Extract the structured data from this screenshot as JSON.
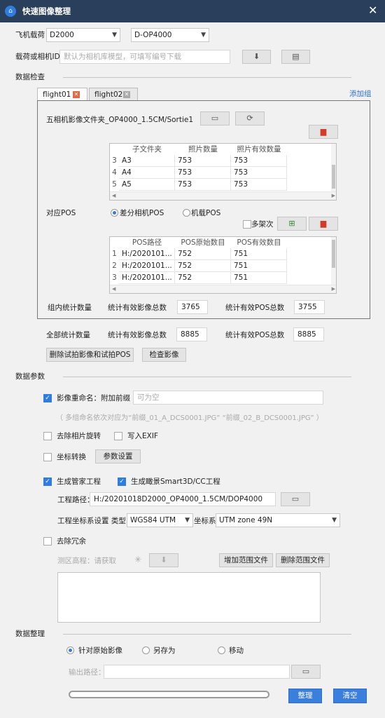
{
  "window": {
    "title": "快速图像整理",
    "close": "✕",
    "logo": "⌂"
  },
  "platform": {
    "aircraft_label": "飞机载荷",
    "aircraft": "D2000",
    "payload": "D-OP4000"
  },
  "camera_id": {
    "label": "载荷或相机ID",
    "placeholder": "默认为相机库模型，可填写编号下载"
  },
  "sections": {
    "check": "数据检查",
    "params": "数据参数",
    "organize": "数据整理"
  },
  "tabs": [
    {
      "label": "flight01"
    },
    {
      "label": "flight02"
    }
  ],
  "add_group": "添加组",
  "images": {
    "folder_label": "五相机影像文件夹",
    "folder_value": "_OP4000_1.5CM/Sortie1",
    "columns": [
      "子文件夹",
      "照片数量",
      "照片有效数量"
    ],
    "rows": [
      {
        "no": "3",
        "a": "A3",
        "b": "753",
        "c": "753"
      },
      {
        "no": "4",
        "a": "A4",
        "b": "753",
        "c": "753"
      },
      {
        "no": "5",
        "a": "A5",
        "b": "753",
        "c": "753"
      }
    ]
  },
  "pos": {
    "label": "对应POS",
    "radio_diff": "差分相机POS",
    "radio_onboard": "机载POS",
    "multi": "多架次",
    "columns": [
      "POS路径",
      "POS原始数目",
      "POS有效数目"
    ],
    "rows": [
      {
        "no": "1",
        "a": "H:/2020101...",
        "b": "752",
        "c": "751"
      },
      {
        "no": "2",
        "a": "H:/2020101...",
        "b": "752",
        "c": "751"
      },
      {
        "no": "3",
        "a": "H:/2020101...",
        "b": "752",
        "c": "751"
      }
    ]
  },
  "group_stats": {
    "label": "组内统计数量",
    "img_label": "统计有效影像总数",
    "img_value": "3765",
    "pos_label": "统计有效POS总数",
    "pos_value": "3755"
  },
  "total_stats": {
    "label": "全部统计数量",
    "img_label": "统计有效影像总数",
    "img_value": "8885",
    "pos_label": "统计有效POS总数",
    "pos_value": "8885"
  },
  "actions": {
    "remove_test": "删除试拍影像和试拍POS",
    "check_images": "检查影像"
  },
  "params": {
    "rename_label": "影像重命名：附加前缀",
    "rename_placeholder": "可为空",
    "rename_hint": "（ 多组命名依次对应为“前缀_01_A_DCS0001.JPG” “前缀_02_B_DCS0001.JPG” ）",
    "remove_rotation": "去除相片旋转",
    "write_exif": "写入EXIF",
    "coord_convert": "坐标转换",
    "param_settings": "参数设置",
    "gen_manager": "生成管家工程",
    "gen_smart3d": "生成瞰景Smart3D/CC工程",
    "project_path_label": "工程路径：",
    "project_path": "H:/20201018D2000_OP4000_1.5CM/DOP4000",
    "crs_label": "工程坐标系设置 类型",
    "crs_type": "WGS84 UTM",
    "crs_sys_label": "坐标系",
    "crs_sys": "UTM zone 49N",
    "remove_redundant": "去除冗余",
    "elevation_label": "测区高程：请获取",
    "add_range": "增加范围文件",
    "delete_range": "删除范围文件"
  },
  "organize": {
    "radio_original": "针对原始影像",
    "radio_saveas": "另存为",
    "radio_move": "移动",
    "output_label": "输出路径：",
    "progress": 0
  },
  "buttons": {
    "organize": "整理",
    "clear": "清空"
  }
}
